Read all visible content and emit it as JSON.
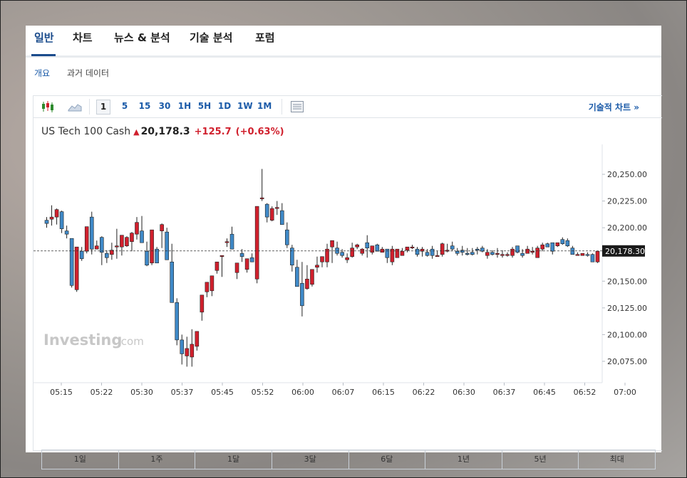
{
  "tabs": [
    {
      "label": "일반",
      "active": true
    },
    {
      "label": "차트",
      "active": false
    },
    {
      "label": "뉴스 & 분석",
      "active": false
    },
    {
      "label": "기술 분석",
      "active": false
    },
    {
      "label": "포럼",
      "active": false
    }
  ],
  "subnav": {
    "overview": "개요",
    "history": "과거 데이터"
  },
  "toolbar": {
    "chart_type_icons": [
      "candlestick-icon",
      "area-chart-icon"
    ],
    "intervals": [
      "1",
      "5",
      "15",
      "30",
      "1H",
      "5H",
      "1D",
      "1W",
      "1M"
    ],
    "selected_interval": "1",
    "indicator_icon": "indicator-panel-icon",
    "advanced_chart": "기술적 차트 »"
  },
  "quote": {
    "name": "US Tech 100 Cash",
    "price": "20,178.3",
    "change": "+125.7",
    "change_pct": "(+0.63%)",
    "direction": "up",
    "up_color": "#d0202d"
  },
  "watermark": {
    "brand": "Investing",
    "suffix": ".com"
  },
  "chart_data": {
    "type": "candlestick",
    "x_ticks": [
      "05:15",
      "05:22",
      "05:30",
      "05:37",
      "05:45",
      "05:52",
      "06:00",
      "06:07",
      "06:15",
      "06:22",
      "06:30",
      "06:37",
      "06:45",
      "06:52",
      "07:00"
    ],
    "y_ticks": [
      "20,250.00",
      "20,225.00",
      "20,200.00",
      "20,150.00",
      "20,125.00",
      "20,100.00",
      "20,075.00"
    ],
    "ylim": [
      20055,
      20270
    ],
    "last_price": 20178.3,
    "last_price_label": "20,178.30",
    "up_color": "#d0202d",
    "down_color": "#3f89c7",
    "candles": [
      [
        20207,
        20210,
        20200,
        20204
      ],
      [
        20208,
        20221,
        20202,
        20210
      ],
      [
        20210,
        20218,
        20203,
        20217
      ],
      [
        20215,
        20216,
        20195,
        20199
      ],
      [
        20197,
        20202,
        20190,
        20194
      ],
      [
        20190,
        20190,
        20144,
        20146
      ],
      [
        20142,
        20182,
        20140,
        20182
      ],
      [
        20178,
        20182,
        20169,
        20171
      ],
      [
        20178,
        20201,
        20176,
        20201
      ],
      [
        20210,
        20215,
        20175,
        20180
      ],
      [
        20180,
        20188,
        20180,
        20183
      ],
      [
        20191,
        20192,
        20165,
        20177
      ],
      [
        20176,
        20179,
        20167,
        20172
      ],
      [
        20175,
        20186,
        20170,
        20179
      ],
      [
        20183,
        20199,
        20171,
        20183
      ],
      [
        20182,
        20189,
        20174,
        20193
      ],
      [
        20183,
        20192,
        20182,
        20191
      ],
      [
        20187,
        20196,
        20178,
        20195
      ],
      [
        20194,
        20210,
        20189,
        20205
      ],
      [
        20197,
        20211,
        20186,
        20186
      ],
      [
        20178,
        20187,
        20164,
        20165
      ],
      [
        20167,
        20198,
        20165,
        20198
      ],
      [
        20180,
        20182,
        20168,
        20167
      ],
      [
        20197,
        20204,
        20181,
        20203
      ],
      [
        20196,
        20200,
        20172,
        20170
      ],
      [
        20168,
        20185,
        20164,
        20130
      ],
      [
        20130,
        20134,
        20090,
        20095
      ],
      [
        20095,
        20100,
        20072,
        20082
      ],
      [
        20080,
        20098,
        20070,
        20087
      ],
      [
        20079,
        20105,
        20070,
        20091
      ],
      [
        20089,
        20103,
        20085,
        20103
      ],
      [
        20121,
        20136,
        20113,
        20137
      ],
      [
        20140,
        20143,
        20135,
        20149
      ],
      [
        20141,
        20154,
        20136,
        20155
      ],
      [
        20160,
        20167,
        20157,
        20168
      ],
      [
        20173,
        20174,
        20154,
        20174
      ],
      [
        20186,
        20190,
        20182,
        20187
      ],
      [
        20194,
        20201,
        20180,
        20180
      ],
      [
        20158,
        20167,
        20152,
        20167
      ],
      [
        20176,
        20180,
        20168,
        20173
      ],
      [
        20161,
        20164,
        20158,
        20171
      ],
      [
        20172,
        20176,
        20168,
        20168
      ],
      [
        20152,
        20185,
        20148,
        20220
      ],
      [
        20228,
        20255,
        20225,
        20228
      ],
      [
        20222,
        20223,
        20205,
        20210
      ],
      [
        20207,
        20220,
        20206,
        20218
      ],
      [
        20218,
        20225,
        20212,
        20219
      ],
      [
        20216,
        20223,
        20205,
        20203
      ],
      [
        20198,
        20205,
        20181,
        20184
      ],
      [
        20181,
        20184,
        20159,
        20165
      ],
      [
        20163,
        20170,
        20147,
        20145
      ],
      [
        20148,
        20168,
        20117,
        20127
      ],
      [
        20143,
        20165,
        20142,
        20152
      ],
      [
        20147,
        20161,
        20145,
        20161
      ],
      [
        20163,
        20173,
        20158,
        20165
      ],
      [
        20168,
        20172,
        20163,
        20173
      ],
      [
        20168,
        20185,
        20163,
        20180
      ],
      [
        20182,
        20187,
        20167,
        20188
      ],
      [
        20181,
        20187,
        20174,
        20176
      ],
      [
        20177,
        20180,
        20172,
        20174
      ],
      [
        20170,
        20176,
        20167,
        20172
      ],
      [
        20173,
        20186,
        20172,
        20181
      ],
      [
        20182,
        20185,
        20180,
        20184
      ],
      [
        20176,
        20181,
        20174,
        20180
      ],
      [
        20186,
        20193,
        20172,
        20181
      ],
      [
        20177,
        20181,
        20175,
        20183
      ],
      [
        20184,
        20185,
        20178,
        20178
      ],
      [
        20177,
        20182,
        20178,
        20180
      ],
      [
        20180,
        20176,
        20167,
        20172
      ],
      [
        20168,
        20183,
        20165,
        20180
      ],
      [
        20172,
        20172,
        20172,
        20180
      ],
      [
        20174,
        20181,
        20174,
        20178
      ],
      [
        20179,
        20182,
        20177,
        20182
      ],
      [
        20182,
        20184,
        20180,
        20182
      ],
      [
        20180,
        20182,
        20173,
        20175
      ],
      [
        20178,
        20182,
        20173,
        20180
      ],
      [
        20177,
        20180,
        20173,
        20174
      ],
      [
        20180,
        20183,
        20171,
        20174
      ],
      [
        20174,
        20178,
        20173,
        20174
      ],
      [
        20175,
        20186,
        20173,
        20185
      ],
      [
        20178,
        20185,
        20177,
        20179
      ],
      [
        20183,
        20187,
        20178,
        20180
      ],
      [
        20178,
        20181,
        20174,
        20176
      ],
      [
        20179,
        20183,
        20174,
        20177
      ],
      [
        20176,
        20181,
        20174,
        20175
      ],
      [
        20177,
        20181,
        20174,
        20175
      ],
      [
        20180,
        20182,
        20175,
        20179
      ],
      [
        20181,
        20183,
        20177,
        20178
      ],
      [
        20174,
        20180,
        20171,
        20177
      ],
      [
        20177,
        20179,
        20174,
        20175
      ],
      [
        20175,
        20181,
        20172,
        20176
      ],
      [
        20175,
        20179,
        20172,
        20175
      ],
      [
        20174,
        20177,
        20173,
        20175
      ],
      [
        20174,
        20182,
        20172,
        20180
      ],
      [
        20183,
        20183,
        20176,
        20177
      ],
      [
        20176,
        20180,
        20172,
        20174
      ],
      [
        20176,
        20183,
        20176,
        20180
      ],
      [
        20177,
        20182,
        20175,
        20178
      ],
      [
        20172,
        20183,
        20172,
        20181
      ],
      [
        20180,
        20186,
        20178,
        20184
      ],
      [
        20185,
        20186,
        20182,
        20182
      ],
      [
        20186,
        20184,
        20175,
        20178
      ],
      [
        20183,
        20186,
        20182,
        20186
      ],
      [
        20189,
        20191,
        20184,
        20185
      ],
      [
        20188,
        20190,
        20182,
        20183
      ],
      [
        20181,
        20183,
        20175,
        20175
      ],
      [
        20175,
        20177,
        20174,
        20175
      ],
      [
        20174,
        20176,
        20174,
        20176
      ],
      [
        20175,
        20177,
        20173,
        20174
      ],
      [
        20175,
        20176,
        20170,
        20168
      ],
      [
        20168,
        20178,
        20167,
        20178
      ]
    ]
  },
  "ranges": [
    "1일",
    "1주",
    "1달",
    "3달",
    "6달",
    "1년",
    "5년",
    "최대"
  ]
}
